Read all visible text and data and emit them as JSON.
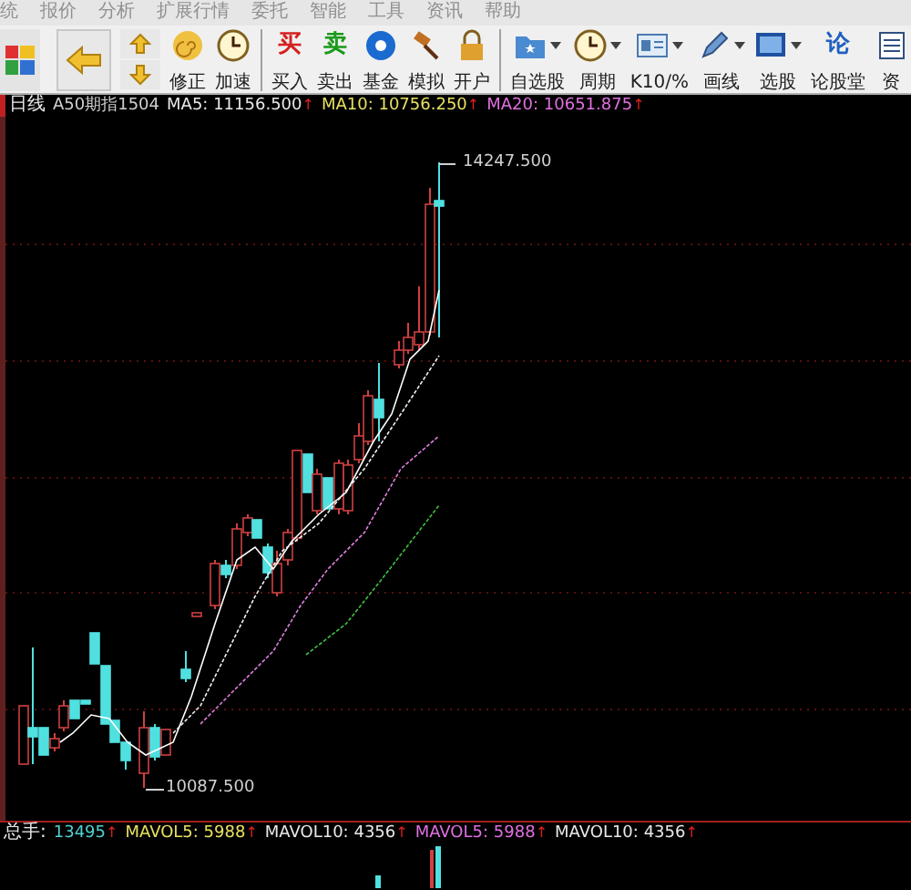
{
  "menu": [
    "统",
    "报价",
    "分析",
    "扩展行情",
    "委托",
    "智能",
    "工具",
    "资讯",
    "帮助"
  ],
  "toolbar": [
    {
      "kind": "tiles"
    },
    {
      "kind": "back"
    },
    {
      "kind": "updown"
    },
    {
      "kind": "spiral",
      "label": "修正"
    },
    {
      "kind": "clock",
      "label": "加速"
    },
    {
      "kind": "separator"
    },
    {
      "kind": "glyph",
      "glyph": "买",
      "color": "#d42020",
      "label": "买入"
    },
    {
      "kind": "glyph",
      "glyph": "卖",
      "color": "#1a9a1a",
      "label": "卖出"
    },
    {
      "kind": "disc",
      "label": "基金"
    },
    {
      "kind": "gavel",
      "label": "模拟"
    },
    {
      "kind": "lock",
      "label": "开户"
    },
    {
      "kind": "separator"
    },
    {
      "kind": "folder",
      "label": "自选股",
      "dropdown": true
    },
    {
      "kind": "clock",
      "label": "周期",
      "dropdown": true
    },
    {
      "kind": "card",
      "label": "K10/%",
      "dropdown": true
    },
    {
      "kind": "pencil",
      "label": "画线",
      "dropdown": true
    },
    {
      "kind": "monitor",
      "label": "选股",
      "dropdown": true
    },
    {
      "kind": "glyph",
      "glyph": "论",
      "color": "#2060c0",
      "label": "论股堂"
    },
    {
      "kind": "doc",
      "label": "资"
    }
  ],
  "chart_header": {
    "period": "日线",
    "symbol": "A50期指1504",
    "indicators": [
      {
        "label": "MA5:",
        "value": "11156.500",
        "arrow": "↑",
        "color": "#e8e8e8"
      },
      {
        "label": "MA10:",
        "value": "10756.250",
        "arrow": "↑",
        "color": "#e8e060"
      },
      {
        "label": "MA20:",
        "value": "10651.875",
        "arrow": "↑",
        "color": "#e070e0"
      }
    ]
  },
  "price_labels": {
    "high": "14247.500",
    "low": "10087.500"
  },
  "volume_header": {
    "label": "总手:",
    "value": "13495",
    "arrow": "↑",
    "indicators": [
      {
        "label": "MAVOL5:",
        "value": "5988",
        "arrow": "↑",
        "color": "#e8e060"
      },
      {
        "label": "MAVOL10:",
        "value": "4356",
        "arrow": "↑",
        "color": "#e8e8e8"
      },
      {
        "label": "MAVOL5:",
        "value": "5988",
        "arrow": "↑",
        "color": "#e070e0"
      },
      {
        "label": "MAVOL10:",
        "value": "4356",
        "arrow": "↑",
        "color": "#e8e8e8"
      }
    ]
  }
}
